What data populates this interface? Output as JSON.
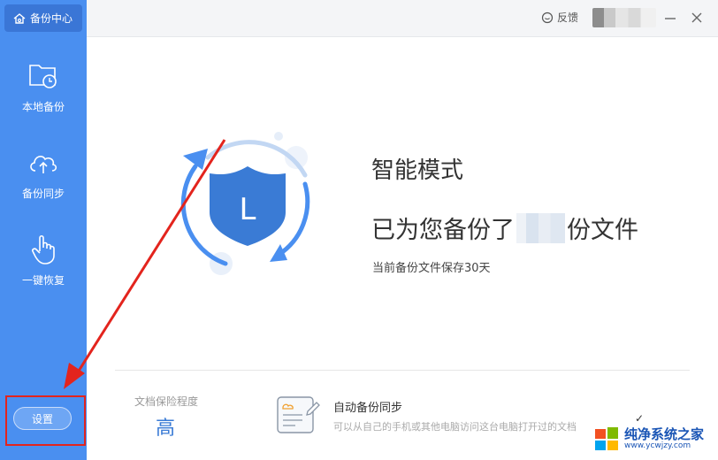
{
  "sidebar": {
    "app_title": "备份中心",
    "items": [
      {
        "label": "本地备份",
        "icon": "folder-clock-icon"
      },
      {
        "label": "备份同步",
        "icon": "cloud-upload-icon"
      },
      {
        "label": "一键恢复",
        "icon": "hand-pointer-icon"
      }
    ],
    "settings_label": "设置"
  },
  "titlebar": {
    "feedback_label": "反馈"
  },
  "main": {
    "mode_title": "智能模式",
    "backup_prefix": "已为您备份了",
    "backup_suffix": "份文件",
    "retain_text": "当前备份文件保存30天",
    "shield_letter": "L"
  },
  "bottom": {
    "protect_label": "文档保险程度",
    "protect_value": "高",
    "sync_title": "自动备份同步",
    "sync_desc": "可以从自己的手机或其他电脑访问这台电脑打开过的文档"
  },
  "watermark": {
    "name": "纯净系统之家",
    "url": "www.ycwjzy.com"
  },
  "colors": {
    "sidebar": "#4a8ff0",
    "accent": "#3a7bd5",
    "annotation": "#e3241d"
  }
}
